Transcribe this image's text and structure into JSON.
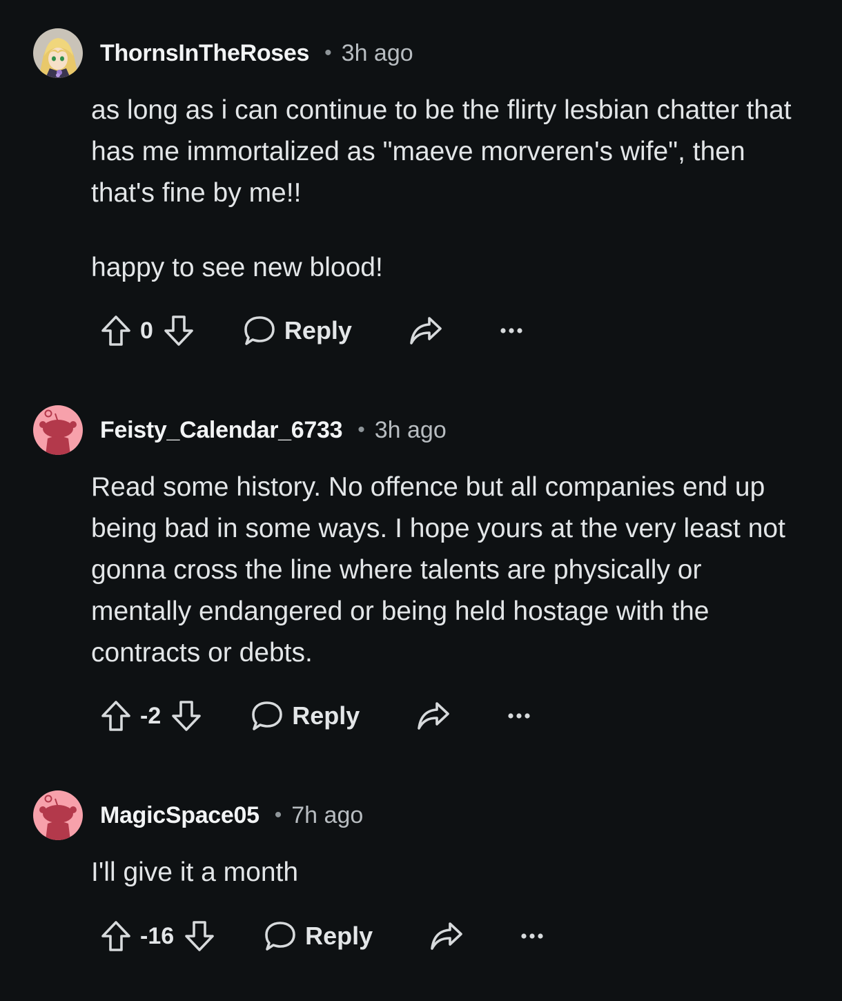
{
  "comments": [
    {
      "username": "ThornsInTheRoses",
      "separator": "•",
      "time": "3h ago",
      "paragraphs": [
        "as long as i can continue to be the flirty lesbian chatter that has me immortalized as \"maeve morveren's wife\", then that's fine by me!!",
        "happy to see new blood!"
      ],
      "score": "0",
      "reply_label": "Reply"
    },
    {
      "username": "Feisty_Calendar_6733",
      "separator": "•",
      "time": "3h ago",
      "paragraphs": [
        "Read some history. No offence but all companies end up being bad in some ways. I hope yours at the very least not gonna cross the line where talents are physically or mentally endangered or being held hostage with the contracts or debts."
      ],
      "score": "-2",
      "reply_label": "Reply"
    },
    {
      "username": "MagicSpace05",
      "separator": "•",
      "time": "7h ago",
      "paragraphs": [
        "I'll give it a month"
      ],
      "score": "-16",
      "reply_label": "Reply"
    }
  ],
  "icons": {
    "upvote": "upvote-arrow-icon",
    "downvote": "downvote-arrow-icon",
    "reply": "speech-bubble-icon",
    "share": "share-arrow-icon",
    "more": "more-dots-icon",
    "default_avatar": "snoo-avatar-icon",
    "custom_avatar": "anime-avatar"
  },
  "colors": {
    "background": "#0e1113",
    "default_avatar_bg": "#f7a1ab",
    "text": "#d7dadc"
  }
}
